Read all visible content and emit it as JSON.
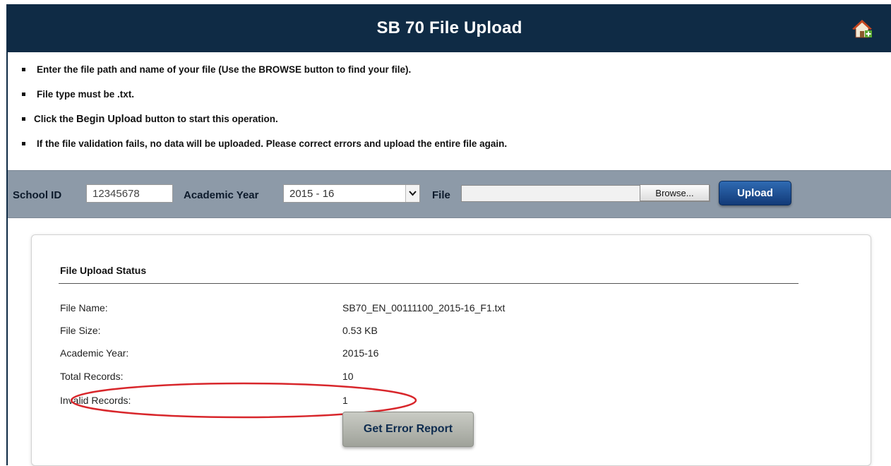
{
  "header": {
    "title": "SB 70 File Upload",
    "home_icon": "home-icon"
  },
  "instructions": [
    {
      "before": "",
      "strong": "",
      "after": "Enter the file path and name of your file (Use the BROWSE button to find your file)."
    },
    {
      "before": "",
      "strong": "",
      "after": "File type must be .txt."
    },
    {
      "before": "Click the ",
      "strong": "Begin Upload",
      "after": "button to start this operation."
    },
    {
      "before": "",
      "strong": "",
      "after": "If the file validation fails, no data will be uploaded. Please correct errors and upload the entire file again."
    }
  ],
  "filter": {
    "school_id_label": "School ID",
    "school_id_value": "12345678",
    "academic_year_label": "Academic Year",
    "academic_year_value": "2015 - 16",
    "file_label": "File",
    "file_value": "",
    "browse_label": "Browse...",
    "upload_label": "Upload"
  },
  "status": {
    "title": "File Upload Status",
    "rows": [
      {
        "label": "File Name:",
        "value": "SB70_EN_00111100_2015-16_F1.txt"
      },
      {
        "label": "File Size:",
        "value": "0.53 KB"
      },
      {
        "label": "Academic Year:",
        "value": "2015-16"
      },
      {
        "label": "Total Records:",
        "value": "10"
      },
      {
        "label": "Invalid Records:",
        "value": "1"
      }
    ],
    "error_report_label": "Get Error Report",
    "highlight_color": "#d8262b"
  },
  "colors": {
    "header_bg": "#0f2b45",
    "filter_bg": "#8d9aa8",
    "upload_button": "#1f4f95"
  }
}
